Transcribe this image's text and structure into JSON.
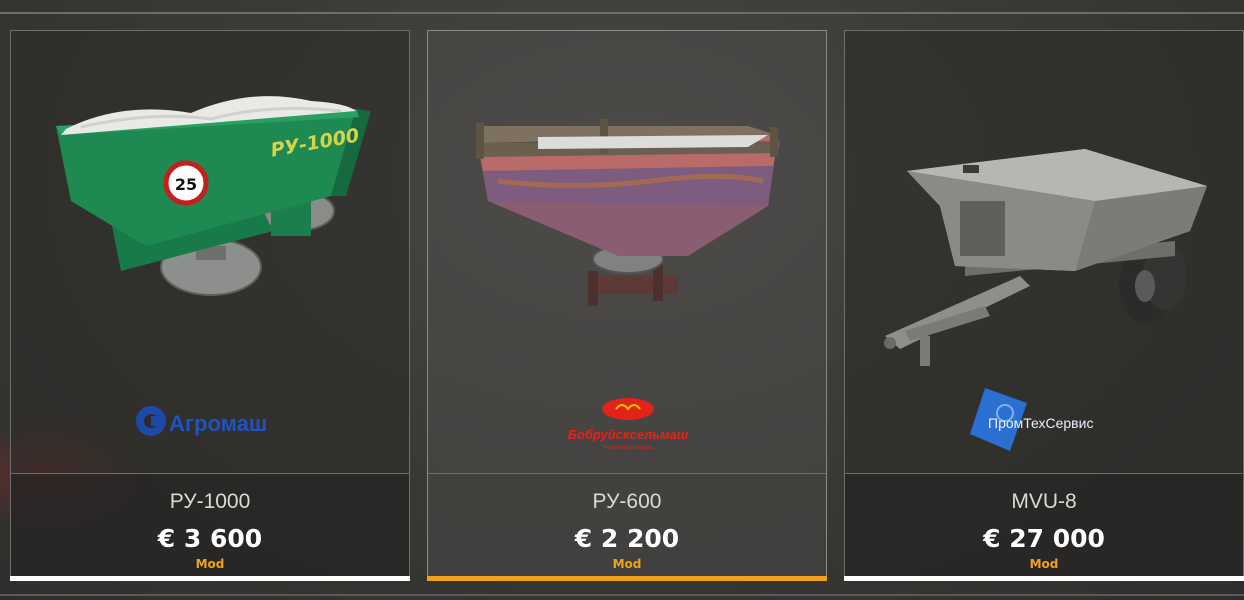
{
  "store": {
    "items": [
      {
        "name": "РУ-1000",
        "price": "€ 3 600",
        "tag": "Mod",
        "brand": "Агромаш",
        "hopper_label": "РУ-1000",
        "badge": "25",
        "selected": false,
        "icon": "green-fertilizer-spreader"
      },
      {
        "name": "РУ-600",
        "price": "€ 2 200",
        "tag": "Mod",
        "brand": "Бобруйсксельмаш",
        "brand_sub": "Республика Беларусь",
        "selected": true,
        "icon": "rusty-fertilizer-spreader"
      },
      {
        "name": "MVU-8",
        "price": "€ 27 000",
        "tag": "Mod",
        "brand": "ПромТехСервис",
        "selected": false,
        "icon": "trailed-fertilizer-spreader"
      }
    ]
  },
  "colors": {
    "accent": "#f0a21c",
    "selected_underline": "#f0a21c",
    "default_underline": "#ffffff",
    "card_border": "#6e6e6b"
  }
}
